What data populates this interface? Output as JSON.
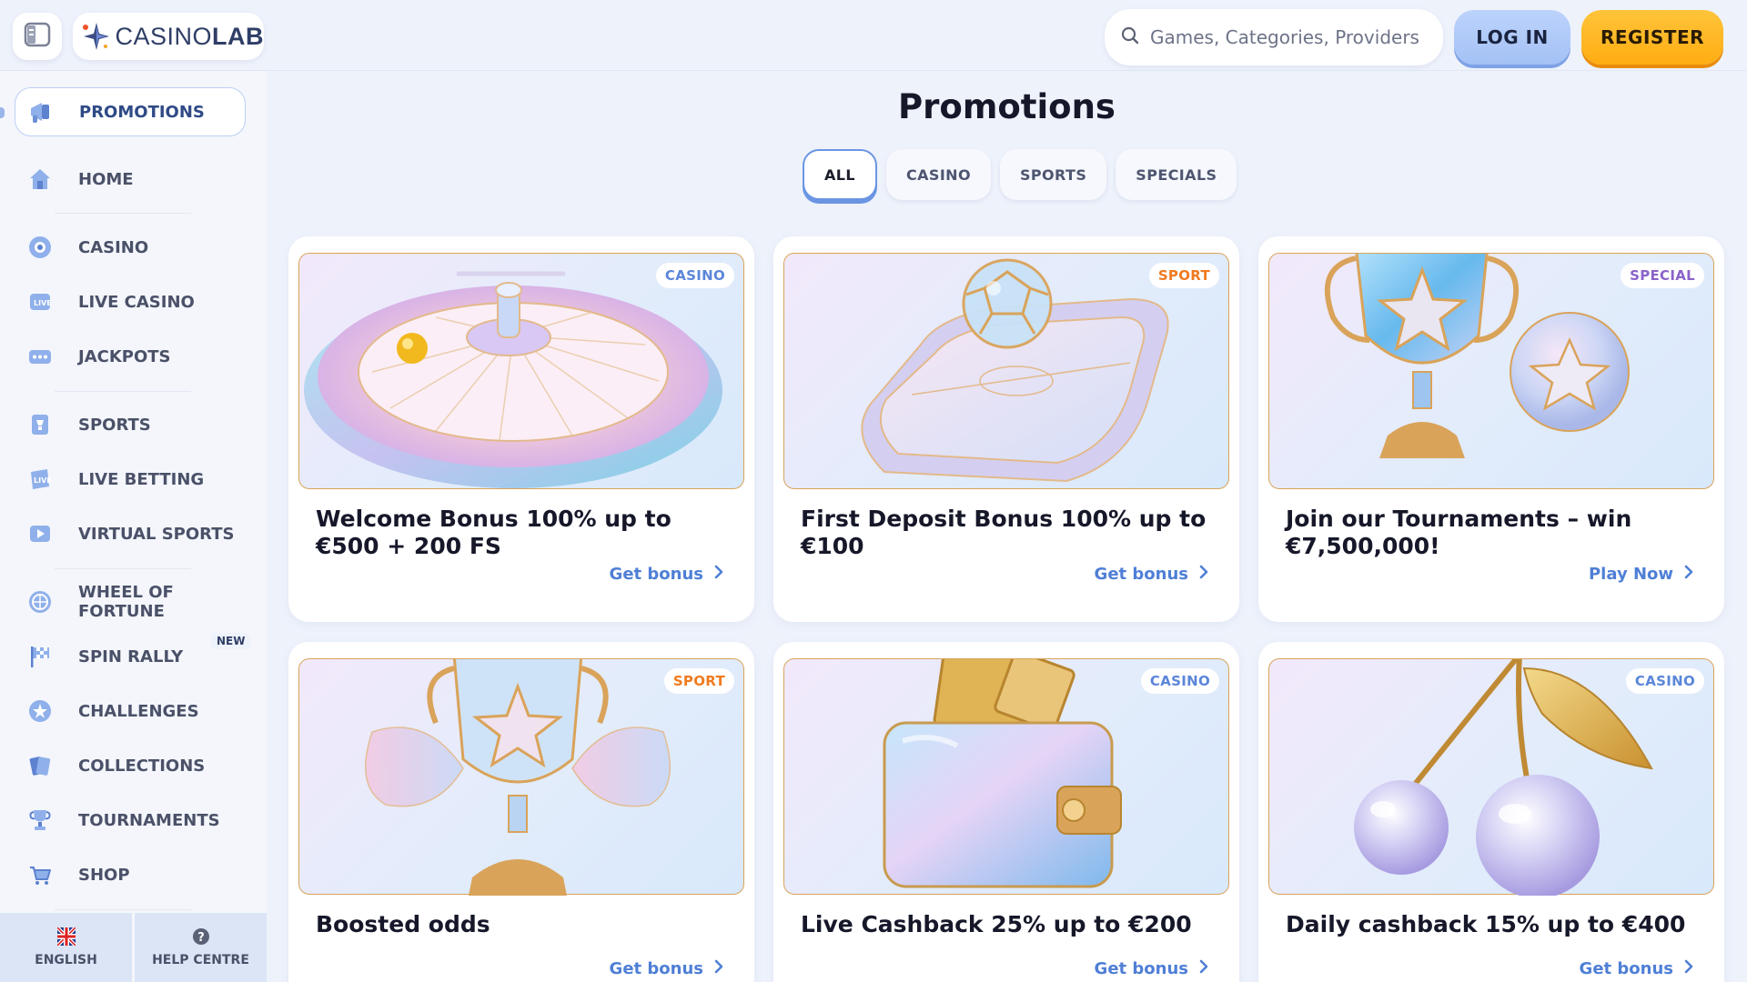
{
  "header": {
    "logo": {
      "part1": "CASINO",
      "part2": "LAB"
    },
    "search": {
      "placeholder": "Games, Categories, Providers"
    },
    "login_label": "LOG IN",
    "register_label": "REGISTER"
  },
  "sidebar": {
    "items": [
      {
        "label": "PROMOTIONS",
        "icon": "megaphone-icon",
        "active": true
      },
      {
        "label": "HOME",
        "icon": "home-icon"
      },
      {
        "label": "CASINO",
        "icon": "casino-chip-icon"
      },
      {
        "label": "LIVE CASINO",
        "icon": "live-casino-icon"
      },
      {
        "label": "JACKPOTS",
        "icon": "jackpot-icon"
      },
      {
        "label": "SPORTS",
        "icon": "sports-icon"
      },
      {
        "label": "LIVE BETTING",
        "icon": "live-betting-icon"
      },
      {
        "label": "VIRTUAL SPORTS",
        "icon": "virtual-sports-icon"
      },
      {
        "label": "WHEEL OF FORTUNE",
        "icon": "wheel-icon"
      },
      {
        "label": "SPIN RALLY",
        "icon": "flag-icon",
        "badge": "NEW"
      },
      {
        "label": "CHALLENGES",
        "icon": "challenge-icon"
      },
      {
        "label": "COLLECTIONS",
        "icon": "cards-icon"
      },
      {
        "label": "TOURNAMENTS",
        "icon": "trophy-icon"
      },
      {
        "label": "SHOP",
        "icon": "cart-icon"
      }
    ],
    "footer": {
      "language_label": "ENGLISH",
      "help_label": "HELP CENTRE"
    }
  },
  "main": {
    "title": "Promotions",
    "tabs": [
      {
        "label": "ALL",
        "active": true
      },
      {
        "label": "CASINO"
      },
      {
        "label": "SPORTS"
      },
      {
        "label": "SPECIALS"
      }
    ],
    "cards": [
      {
        "tag": "CASINO",
        "tag_color": "#5b86d9",
        "title": "Welcome Bonus 100% up to €500 + 200 FS",
        "cta": "Get bonus",
        "image": "roulette-wheel"
      },
      {
        "tag": "SPORT",
        "tag_color": "#f07a1f",
        "title": "First Deposit Bonus 100% up to €100",
        "cta": "Get bonus",
        "image": "football-field"
      },
      {
        "tag": "SPECIAL",
        "tag_color": "#8a63c9",
        "title": "Join our Tournaments – win €7,500,000!",
        "cta": "Play Now",
        "image": "trophy-ball"
      },
      {
        "tag": "SPORT",
        "tag_color": "#f07a1f",
        "title": "Boosted odds",
        "cta": "Get bonus",
        "image": "winged-trophy"
      },
      {
        "tag": "CASINO",
        "tag_color": "#5b86d9",
        "title": "Live Cashback 25% up to €200",
        "cta": "Get bonus",
        "image": "wallet"
      },
      {
        "tag": "CASINO",
        "tag_color": "#5b86d9",
        "title": "Daily cashback 15% up to €400",
        "cta": "Get bonus",
        "image": "cherries"
      }
    ]
  }
}
